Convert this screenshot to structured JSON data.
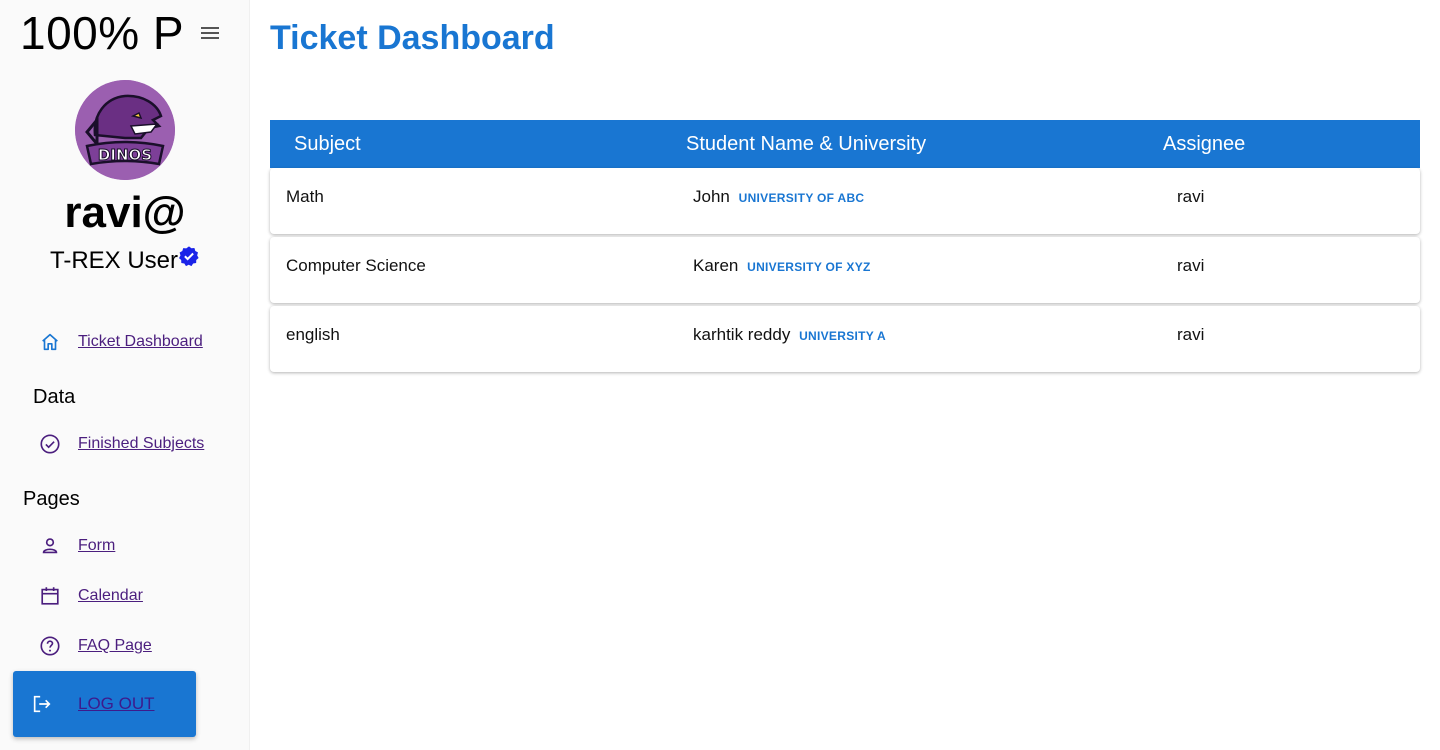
{
  "brand": {
    "text": "100% P"
  },
  "profile": {
    "username": "ravi@",
    "role": "T-REX User",
    "avatar_text": "DINOS"
  },
  "nav": {
    "dashboard": "Ticket Dashboard",
    "section_data": "Data",
    "finished": "Finished Subjects",
    "section_pages": "Pages",
    "form": "Form",
    "calendar": "Calendar",
    "faq": "FAQ Page",
    "logout": "LOG OUT"
  },
  "main": {
    "title": "Ticket Dashboard",
    "columns": [
      "Subject",
      "Student Name & University",
      "Assignee"
    ],
    "rows": [
      {
        "subject": "Math",
        "student": "John",
        "university": "UNIVERSITY OF ABC",
        "assignee": "ravi"
      },
      {
        "subject": "Computer Science",
        "student": "Karen",
        "university": "UNIVERSITY OF XYZ",
        "assignee": "ravi"
      },
      {
        "subject": "english",
        "student": "karhtik reddy",
        "university": "UNIVERSITY A",
        "assignee": "ravi"
      }
    ]
  },
  "colors": {
    "primary": "#1976d2",
    "link": "#4b1e7e",
    "avatar_bg": "#9b5fb0"
  }
}
